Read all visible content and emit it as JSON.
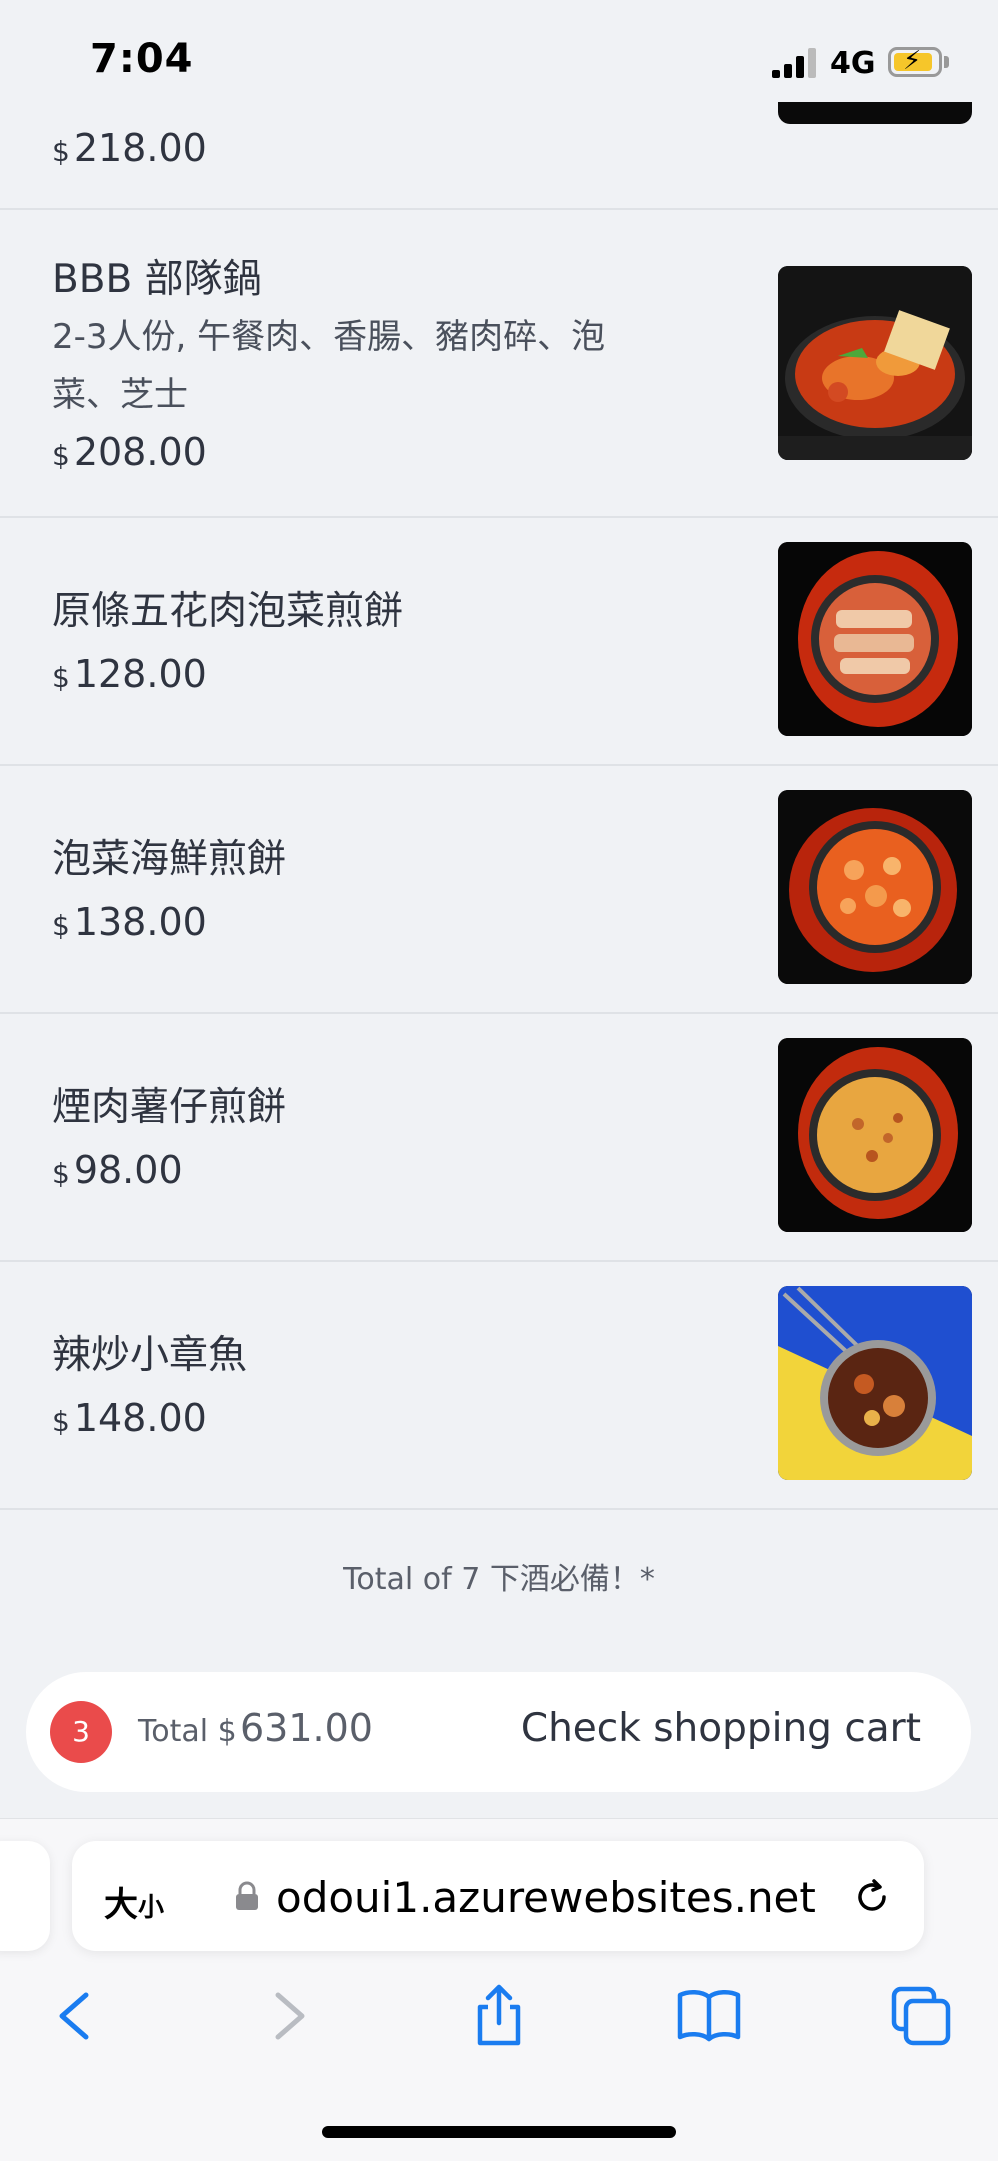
{
  "status_bar": {
    "time": "7:04",
    "network": "4G"
  },
  "menu": {
    "previous_item": {
      "price": "218.00"
    },
    "items": [
      {
        "name": "BBB 部隊鍋",
        "description": "2-3人份, 午餐肉、香腸、豬肉碎、泡菜、芝士",
        "price": "208.00",
        "image": "army-stew-photo"
      },
      {
        "name": "原條五花肉泡菜煎餅",
        "description": "",
        "price": "128.00",
        "image": "pork-belly-kimchi-pancake-photo"
      },
      {
        "name": "泡菜海鮮煎餅",
        "description": "",
        "price": "138.00",
        "image": "kimchi-seafood-pancake-photo"
      },
      {
        "name": "煙肉薯仔煎餅",
        "description": "",
        "price": "98.00",
        "image": "bacon-potato-pancake-photo"
      },
      {
        "name": "辣炒小章魚",
        "description": "",
        "price": "148.00",
        "image": "spicy-stir-fried-octopus-photo"
      }
    ],
    "currency_symbol": "$",
    "total_note": "Total of 7 下酒必備！*"
  },
  "cart": {
    "count": "3",
    "total_label": "Total $",
    "total_value": "631.00",
    "check_label": "Check shopping cart"
  },
  "browser": {
    "text_size_label_big": "大",
    "text_size_label_small": "小",
    "url": "odoui1.azurewebsites.net",
    "icons": [
      "lock-icon",
      "reload-icon",
      "back-icon",
      "forward-icon",
      "share-icon",
      "bookmarks-icon",
      "tabs-icon"
    ]
  },
  "colors": {
    "badge": "#ea4b4b",
    "accent": "#1a7cf0",
    "background": "#f0f2f5"
  }
}
